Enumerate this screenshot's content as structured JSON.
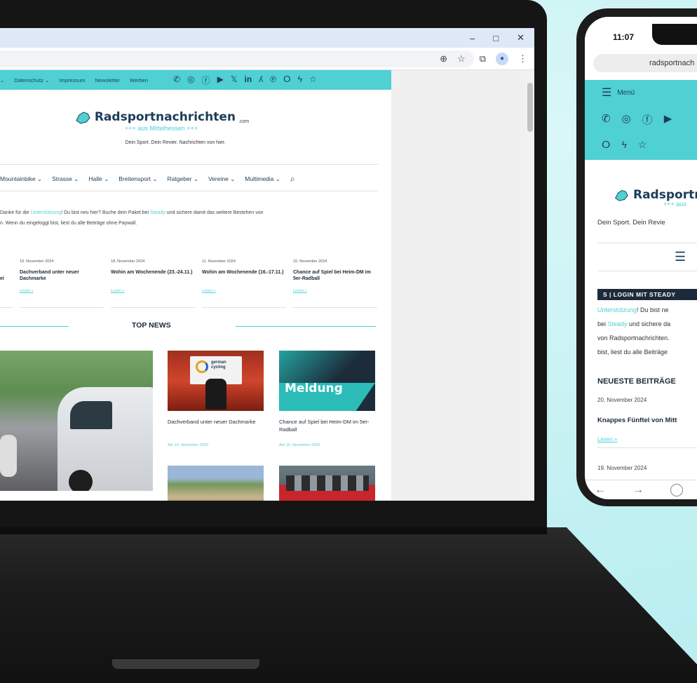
{
  "colors": {
    "accent": "#4fd0d3",
    "navy": "#1c3c58",
    "background": "#bff0f2"
  },
  "browser": {
    "window_min": "–",
    "window_max": "□",
    "window_close": "✕",
    "zoom_icon": "⊕",
    "star_icon": "☆",
    "extensions_icon": "⧉",
    "menu_icon": "⋮"
  },
  "site": {
    "topnav": [
      "Datenschutz ⌄",
      "Impressum",
      "Newsletter",
      "Werben"
    ],
    "topnav_first": "⌄",
    "social_icons": [
      "whatsapp-icon",
      "instagram-icon",
      "facebook-icon",
      "youtube-icon",
      "x-icon",
      "linkedin-icon",
      "strava-icon",
      "pinterest-icon",
      "rss-icon",
      "bolt-icon",
      "star-icon"
    ],
    "social_glyphs": [
      "✆",
      "◎",
      "ⓕ",
      "▶",
      "𝕏",
      "in",
      "ʎ",
      "℗",
      "ⵔ",
      "ϟ",
      "☆"
    ],
    "logo_name": "Radsportnachrichten",
    "logo_com": ".com",
    "logo_sub": "+++ aus Mittelhessen +++",
    "tagline": "Dein Sport. Dein Revier. Nachrichten von hier.",
    "mainnav": [
      "Mountainbike ⌄",
      "Strasse ⌄",
      "Halle ⌄",
      "Breitensport ⌄",
      "Ratgeber ⌄",
      "Vereine ⌄",
      "Multimedia ⌄"
    ],
    "search_icon": "⌕",
    "notice_line1_a": "Danke für die ",
    "notice_link1": "Unterstützung",
    "notice_line1_b": "! Du bist neu hier? Buche dein Paket bei ",
    "notice_link2": "Steady",
    "notice_line1_c": " und sichere damit das weitere Bestehen von",
    "notice_line2": "n. Wenn du eingeloggt bist, liest du alle Beiträge ohne Paywall.",
    "ticker_left_fragment": "ei",
    "ticker": [
      {
        "date": "19. November 2024",
        "title": "Dachverband unter neuer Dachmarke",
        "link": "Lesen »"
      },
      {
        "date": "18. November 2024",
        "title": "Wohin am Wochenende (23.-24.11.)",
        "link": "Lesen »"
      },
      {
        "date": "11. November 2024",
        "title": "Wohin am Wochenende (16.-17.11.)",
        "link": "Lesen »"
      },
      {
        "date": "10. November 2024",
        "title": "Chance auf Spiel bei Heim-DM im 5er-Radball",
        "link": "Lesen »"
      }
    ],
    "topnews_label": "TOP NEWS",
    "cards": [
      {
        "title": "Dachverband unter neuer Dachmarke",
        "date": "Am 19. November 2024",
        "image_text_1": "german",
        "image_text_2": "cycling"
      },
      {
        "title": "Chance auf Spiel bei Heim-DM im 5er-Radball",
        "date": "Am 10. November 2024",
        "image_text": "Meldung"
      }
    ]
  },
  "phone": {
    "time": "11:07",
    "url": "radsportnach",
    "menu_label": "Menü",
    "social_row1": [
      "✆",
      "◎",
      "ⓕ",
      "▶"
    ],
    "social_row2": [
      "ⵔ",
      "ϟ",
      "☆"
    ],
    "logo_name": "Radsportr",
    "logo_sub": "+++ aus",
    "tagline": "Dein Sport. Dein Revie",
    "steady_label": "S | LOGIN MIT STEADY",
    "notice_lines": [
      "Unterstützung! Du bist ne",
      "bei Steady und sichere da",
      "von Radsportnachrichten.",
      "bist, liest du alle Beiträge"
    ],
    "section_title": "NEUESTE BEITRÄGE",
    "date1": "20. November 2024",
    "article1": "Knappes Fünftel von Mitt",
    "lesen": "Lesen »",
    "date2": "19. November 2024",
    "nav_back": "←",
    "nav_forward": "→"
  }
}
